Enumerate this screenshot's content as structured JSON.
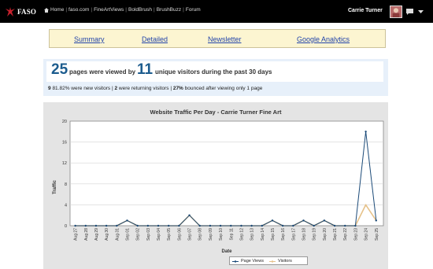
{
  "topbar": {
    "brand": "FASO",
    "nav": [
      "Home",
      "faso.com",
      "FineArtViews",
      "BoldBrush",
      "BrushBuzz",
      "Forum"
    ],
    "user_name": "Carrie Turner"
  },
  "menu": {
    "items": [
      "Summary",
      "Detailed",
      "Newsletter",
      "Google Analytics"
    ]
  },
  "summary": {
    "pages": "25",
    "pages_text": "pages were viewed by",
    "visitors": "11",
    "visitors_text": "unique visitors during the past 30 days",
    "new_count": "9",
    "new_pct": "81.82%",
    "new_text": "were new visitors",
    "returning_count": "2",
    "returning_text": "were returning visitors",
    "bounce_pct": "27%",
    "bounce_text": "bounced after viewing only 1 page",
    "sep": "|"
  },
  "colors": {
    "page_views": "#1b4a78",
    "visitors": "#e6c28a",
    "link": "#2244aa",
    "accent": "#1c5c8e"
  },
  "chart_data": {
    "type": "line",
    "title": "Website Traffic Per Day - Carrie Turner Fine Art",
    "xlabel": "Date",
    "ylabel": "Traffic",
    "ylim": [
      0,
      20
    ],
    "yticks": [
      0,
      4,
      8,
      12,
      16,
      20
    ],
    "grid": true,
    "legend_position": "bottom",
    "categories": [
      "Aug 27",
      "Aug 28",
      "Aug 29",
      "Aug 30",
      "Aug 31",
      "Sep 01",
      "Sep 02",
      "Sep 03",
      "Sep 04",
      "Sep 05",
      "Sep 06",
      "Sep 07",
      "Sep 08",
      "Sep 09",
      "Sep 10",
      "Sep 11",
      "Sep 12",
      "Sep 13",
      "Sep 14",
      "Sep 15",
      "Sep 16",
      "Sep 17",
      "Sep 18",
      "Sep 19",
      "Sep 20",
      "Sep 21",
      "Sep 22",
      "Sep 23",
      "Sep 24",
      "Sep 25"
    ],
    "series": [
      {
        "name": "Page Views",
        "values": [
          0,
          0,
          0,
          0,
          0,
          1,
          0,
          0,
          0,
          0,
          0,
          2,
          0,
          0,
          0,
          0,
          0,
          0,
          0,
          1,
          0,
          0,
          1,
          0,
          1,
          0,
          0,
          0,
          18,
          1
        ]
      },
      {
        "name": "Visitors",
        "values": [
          0,
          0,
          0,
          0,
          0,
          1,
          0,
          0,
          0,
          0,
          0,
          2,
          0,
          0,
          0,
          0,
          0,
          0,
          0,
          1,
          0,
          0,
          1,
          0,
          1,
          0,
          0,
          0,
          4,
          1
        ]
      }
    ]
  }
}
